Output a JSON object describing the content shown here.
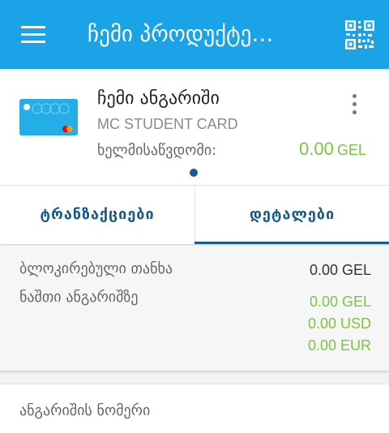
{
  "appbar": {
    "title": "ჩემი პროდუქტე…",
    "bg_color": "#1aa3e6",
    "menu_icon": "hamburger-menu-icon",
    "qr_icon": "qr-code-icon"
  },
  "account": {
    "name": "ჩემი ანგარიში",
    "card_type": "MC STUDENT CARD",
    "available_label": "ხელმისაწვდომი:",
    "available_amount": "0.00",
    "available_currency": "GEL",
    "amount_color": "#7dc342",
    "more_icon": "more-vertical-icon"
  },
  "tabs": [
    {
      "label": "ტრანზაქციები",
      "active": false
    },
    {
      "label": "დეტალები",
      "active": true
    }
  ],
  "details": {
    "blocked_label": "ბლოკირებული თანხა",
    "blocked_value": "0.00 GEL",
    "balance_label": "ნაშთი ანგარიშზე",
    "balances": [
      "0.00 GEL",
      "0.00 USD",
      "0.00 EUR"
    ],
    "account_number_label": "ანგარიშის ნომერი"
  }
}
